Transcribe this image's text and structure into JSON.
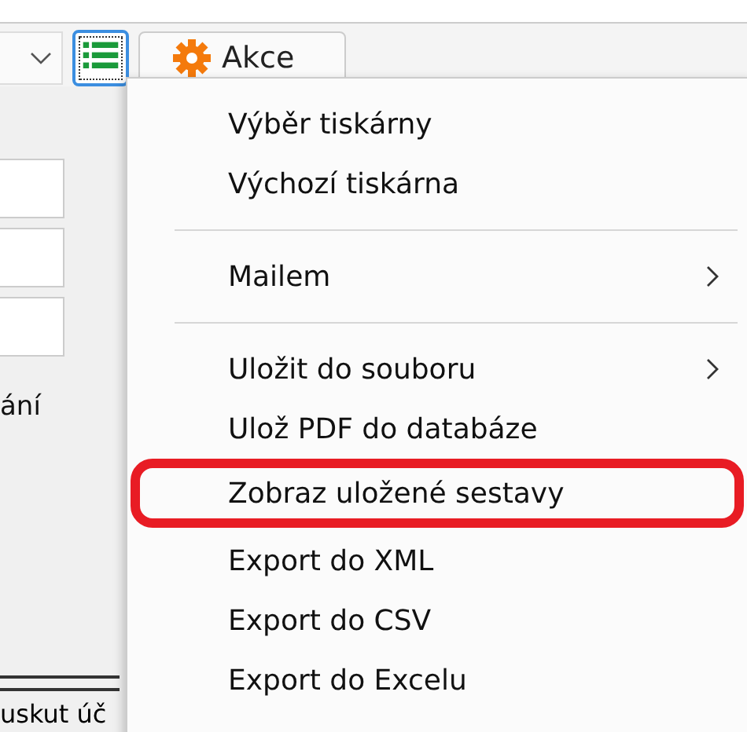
{
  "toolbar": {
    "dropdown_selected": false,
    "report_button_selected": true,
    "action_button": {
      "label": "Akce"
    }
  },
  "left_panel": {
    "label": "ání",
    "footer_text": "uskut úč"
  },
  "menu": {
    "items": [
      {
        "kind": "item",
        "label": "Výběr tiskárny",
        "submenu": false,
        "highlighted": false
      },
      {
        "kind": "item",
        "label": "Výchozí tiskárna",
        "submenu": false,
        "highlighted": false
      },
      {
        "kind": "separator"
      },
      {
        "kind": "item",
        "label": "Mailem",
        "submenu": true,
        "highlighted": false
      },
      {
        "kind": "separator"
      },
      {
        "kind": "item",
        "label": "Uložit do souboru",
        "submenu": true,
        "highlighted": false
      },
      {
        "kind": "item",
        "label": "Ulož PDF do databáze",
        "submenu": false,
        "highlighted": false
      },
      {
        "kind": "item",
        "label": "Zobraz uložené sestavy",
        "submenu": false,
        "highlighted": true
      },
      {
        "kind": "item",
        "label": "Export do XML",
        "submenu": false,
        "highlighted": false
      },
      {
        "kind": "item",
        "label": "Export do CSV",
        "submenu": false,
        "highlighted": false
      },
      {
        "kind": "item",
        "label": "Export do Excelu",
        "submenu": false,
        "highlighted": false
      }
    ]
  }
}
